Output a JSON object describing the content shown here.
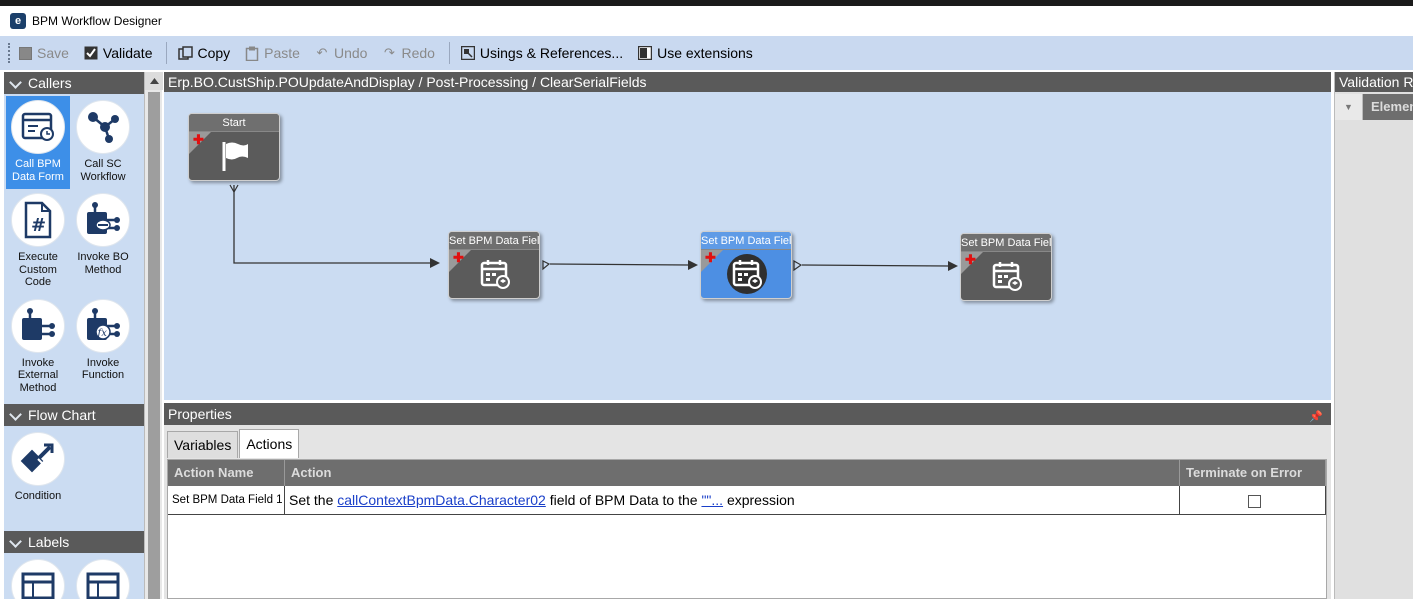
{
  "window": {
    "title": "BPM Workflow Designer"
  },
  "toolbar": {
    "items": [
      {
        "label": "Save",
        "icon": "save-icon",
        "enabled": false
      },
      {
        "label": "Validate",
        "icon": "validate-checkbox-icon",
        "enabled": true
      },
      {
        "label": "Copy",
        "icon": "copy-icon",
        "enabled": true
      },
      {
        "label": "Paste",
        "icon": "paste-icon",
        "enabled": false
      },
      {
        "label": "Undo",
        "icon": "undo-icon",
        "enabled": false
      },
      {
        "label": "Redo",
        "icon": "redo-icon",
        "enabled": false
      },
      {
        "label": "Usings & References...",
        "icon": "usings-icon",
        "enabled": true
      },
      {
        "label": "Use extensions",
        "icon": "checkbox-icon",
        "enabled": true
      }
    ]
  },
  "toolbox": {
    "callers": {
      "title": "Callers",
      "tools": [
        {
          "label": "Call BPM Data Form",
          "icon": "bpm-data-form-icon",
          "selected": true
        },
        {
          "label": "Call SC Workflow",
          "icon": "sc-workflow-icon",
          "selected": false
        },
        {
          "label": "Execute Custom Code",
          "icon": "custom-code-icon",
          "selected": false
        },
        {
          "label": "Invoke BO Method",
          "icon": "bo-method-icon",
          "selected": false
        },
        {
          "label": "Invoke External Method",
          "icon": "external-method-icon",
          "selected": false
        },
        {
          "label": "Invoke Function",
          "icon": "function-icon",
          "selected": false
        }
      ]
    },
    "flow_chart": {
      "title": "Flow Chart",
      "tools": [
        {
          "label": "Condition",
          "icon": "condition-icon"
        }
      ]
    },
    "labels": {
      "title": "Labels"
    }
  },
  "canvas": {
    "breadcrumb": "Erp.BO.CustShip.POUpdateAndDisplay / Post-Processing / ClearSerialFields",
    "nodes": [
      {
        "id": "start",
        "label": "Start",
        "icon": "flag-icon",
        "selected": false
      },
      {
        "id": "set1",
        "label": "Set BPM Data Fielc",
        "icon": "calendar-data-icon",
        "selected": false
      },
      {
        "id": "set2",
        "label": "Set BPM Data Fielc",
        "icon": "calendar-data-icon",
        "selected": true
      },
      {
        "id": "set3",
        "label": "Set BPM Data Fielc",
        "icon": "calendar-data-icon",
        "selected": false
      }
    ]
  },
  "properties": {
    "title": "Properties",
    "tabs": [
      {
        "label": "Variables",
        "active": false
      },
      {
        "label": "Actions",
        "active": true
      }
    ],
    "columns": [
      "Action Name",
      "Action",
      "Terminate on Error"
    ],
    "rows": [
      {
        "name": "Set BPM Data Field 1",
        "action_prefix": "Set the ",
        "action_link": "callContextBpmData.Character02",
        "action_middle": " field of BPM Data to the ",
        "action_link2": "\"\"...",
        "action_suffix": " expression",
        "terminate": false
      }
    ]
  },
  "validation": {
    "title": "Validation R",
    "column": "Elemen"
  }
}
